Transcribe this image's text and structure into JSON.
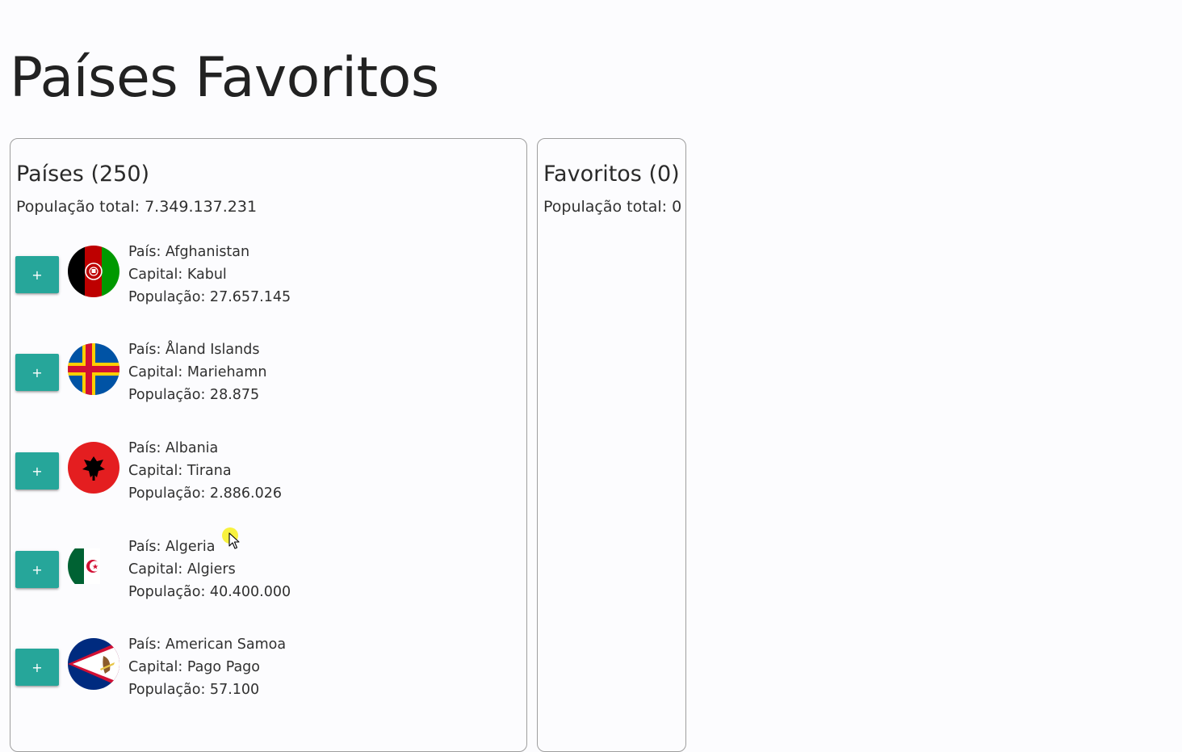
{
  "title": "Países Favoritos",
  "countries_panel": {
    "title": "Países (250)",
    "population": "População total: 7.349.137.231",
    "add_label": "+",
    "items": [
      {
        "flag": "afghanistan-flag-icon",
        "country": "País: Afghanistan",
        "capital": "Capital: Kabul",
        "population": "População: 27.657.145"
      },
      {
        "flag": "aland-islands-flag-icon",
        "country": "País: Åland Islands",
        "capital": "Capital: Mariehamn",
        "population": "População: 28.875"
      },
      {
        "flag": "albania-flag-icon",
        "country": "País: Albania",
        "capital": "Capital: Tirana",
        "population": "População: 2.886.026"
      },
      {
        "flag": "algeria-flag-icon",
        "country": "País: Algeria",
        "capital": "Capital: Algiers",
        "population": "População: 40.400.000"
      },
      {
        "flag": "american-samoa-flag-icon",
        "country": "País: American Samoa",
        "capital": "Capital: Pago Pago",
        "population": "População: 57.100"
      }
    ]
  },
  "favorites_panel": {
    "title": "Favoritos (0)",
    "population": "População total: 0"
  },
  "colors": {
    "button": "#26a69a",
    "border": "#9e9e9e",
    "background": "#fcfcfe"
  }
}
